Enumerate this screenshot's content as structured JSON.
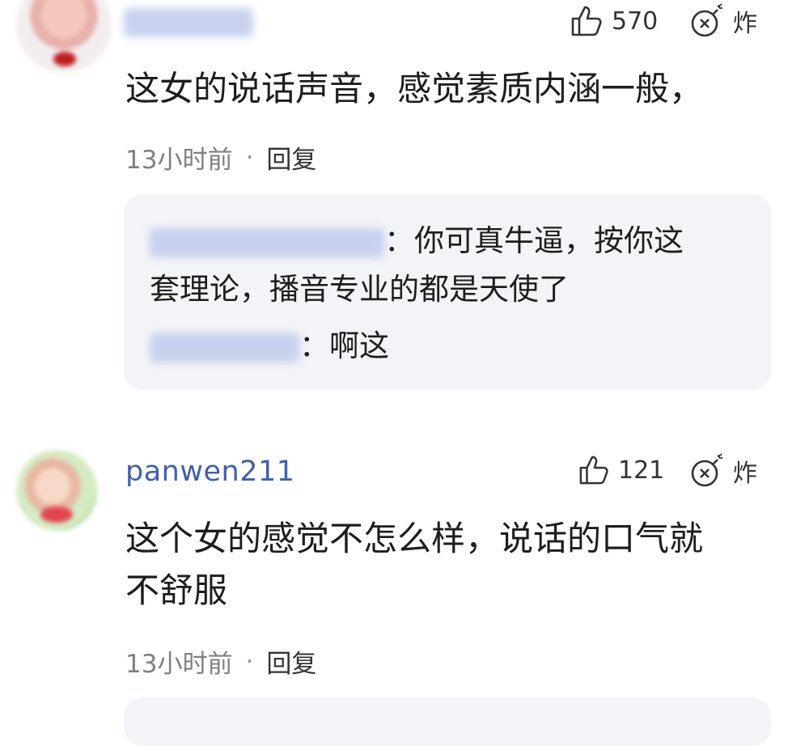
{
  "comments": [
    {
      "username": "",
      "likes": "570",
      "bomb_label": "炸",
      "text": "这女的说话声音，感觉素质内涵一般，",
      "time": "13小时前",
      "separator": "·",
      "reply_label": "回复",
      "replies": [
        {
          "text_line1": "：你可真牛逼，按你这",
          "text_line2": "套理论，播音专业的都是天使了"
        },
        {
          "text_line1": "：啊这"
        }
      ]
    },
    {
      "username": "panwen211",
      "likes": "121",
      "bomb_label": "炸",
      "text_line1": "这个女的感觉不怎么样，说话的口气就",
      "text_line2": "不舒服",
      "time": "13小时前",
      "separator": "·",
      "reply_label": "回复"
    }
  ],
  "icons": {
    "like": "thumbs-up-icon",
    "bomb": "bomb-icon"
  }
}
